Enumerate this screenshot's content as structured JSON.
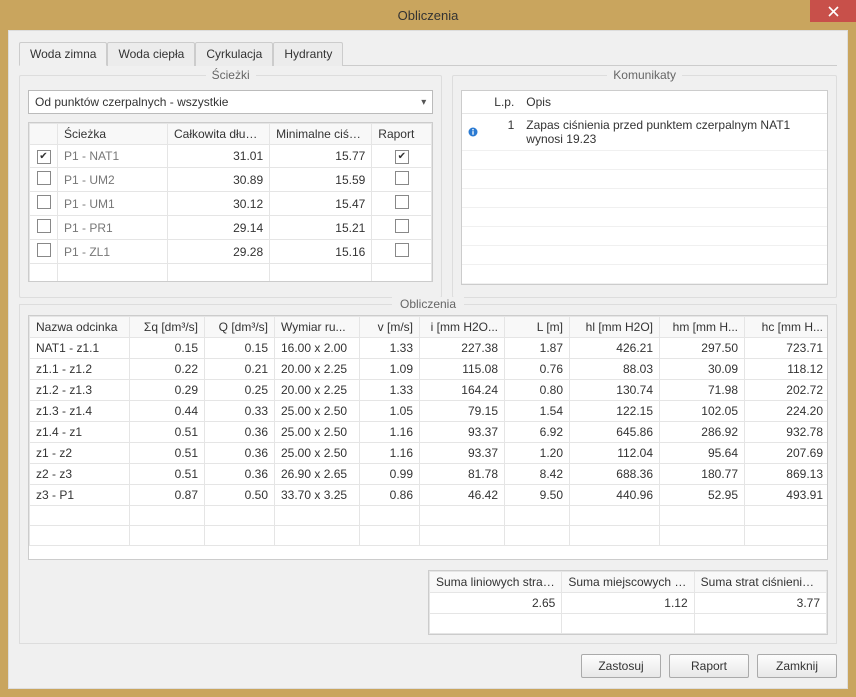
{
  "window": {
    "title": "Obliczenia"
  },
  "tabs": {
    "items": [
      {
        "label": "Woda zimna",
        "active": true
      },
      {
        "label": "Woda ciepła",
        "active": false
      },
      {
        "label": "Cyrkulacja",
        "active": false
      },
      {
        "label": "Hydranty",
        "active": false
      }
    ]
  },
  "paths_group": {
    "legend": "Ścieżki",
    "dropdown": "Od punktów czerpalnych - wszystkie",
    "columns": {
      "check": "",
      "path": "Ścieżka",
      "length": "Całkowita długo...",
      "min_press": "Minimalne ciśnie...",
      "report": "Raport"
    },
    "rows": [
      {
        "checked": true,
        "path": "P1 - NAT1",
        "length": "31.01",
        "min_press": "15.77",
        "report": true
      },
      {
        "checked": false,
        "path": "P1 - UM2",
        "length": "30.89",
        "min_press": "15.59",
        "report": false
      },
      {
        "checked": false,
        "path": "P1 - UM1",
        "length": "30.12",
        "min_press": "15.47",
        "report": false
      },
      {
        "checked": false,
        "path": "P1 - PR1",
        "length": "29.14",
        "min_press": "15.21",
        "report": false
      },
      {
        "checked": false,
        "path": "P1 - ZL1",
        "length": "29.28",
        "min_press": "15.16",
        "report": false
      }
    ]
  },
  "messages_group": {
    "legend": "Komunikaty",
    "columns": {
      "icon": "",
      "lp": "L.p.",
      "desc": "Opis"
    },
    "rows": [
      {
        "icon": "info",
        "lp": "1",
        "desc": "Zapas ciśnienia przed punktem czerpalnym NAT1 wynosi 19.23"
      }
    ]
  },
  "calc_group": {
    "legend": "Obliczenia",
    "columns": {
      "name": "Nazwa odcinka",
      "sq": "Σq [dm³/s]",
      "q": "Q [dm³/s]",
      "dim": "Wymiar ru...",
      "v": "v [m/s]",
      "i": "i [mm H2O...",
      "l": "L [m]",
      "hl": "hl [mm H2O]",
      "hm": "hm [mm H...",
      "hc": "hc [mm H..."
    },
    "rows": [
      {
        "name": "NAT1 - z1.1",
        "sq": "0.15",
        "q": "0.15",
        "dim": "16.00 x 2.00",
        "v": "1.33",
        "i": "227.38",
        "l": "1.87",
        "hl": "426.21",
        "hm": "297.50",
        "hc": "723.71"
      },
      {
        "name": "z1.1 - z1.2",
        "sq": "0.22",
        "q": "0.21",
        "dim": "20.00 x 2.25",
        "v": "1.09",
        "i": "115.08",
        "l": "0.76",
        "hl": "88.03",
        "hm": "30.09",
        "hc": "118.12"
      },
      {
        "name": "z1.2 - z1.3",
        "sq": "0.29",
        "q": "0.25",
        "dim": "20.00 x 2.25",
        "v": "1.33",
        "i": "164.24",
        "l": "0.80",
        "hl": "130.74",
        "hm": "71.98",
        "hc": "202.72"
      },
      {
        "name": "z1.3 - z1.4",
        "sq": "0.44",
        "q": "0.33",
        "dim": "25.00 x 2.50",
        "v": "1.05",
        "i": "79.15",
        "l": "1.54",
        "hl": "122.15",
        "hm": "102.05",
        "hc": "224.20"
      },
      {
        "name": "z1.4 - z1",
        "sq": "0.51",
        "q": "0.36",
        "dim": "25.00 x 2.50",
        "v": "1.16",
        "i": "93.37",
        "l": "6.92",
        "hl": "645.86",
        "hm": "286.92",
        "hc": "932.78"
      },
      {
        "name": "z1 - z2",
        "sq": "0.51",
        "q": "0.36",
        "dim": "25.00 x 2.50",
        "v": "1.16",
        "i": "93.37",
        "l": "1.20",
        "hl": "112.04",
        "hm": "95.64",
        "hc": "207.69"
      },
      {
        "name": "z2 - z3",
        "sq": "0.51",
        "q": "0.36",
        "dim": "26.90 x 2.65",
        "v": "0.99",
        "i": "81.78",
        "l": "8.42",
        "hl": "688.36",
        "hm": "180.77",
        "hc": "869.13"
      },
      {
        "name": "z3 - P1",
        "sq": "0.87",
        "q": "0.50",
        "dim": "33.70 x 3.25",
        "v": "0.86",
        "i": "46.42",
        "l": "9.50",
        "hl": "440.96",
        "hm": "52.95",
        "hc": "493.91"
      }
    ],
    "summary": {
      "columns": {
        "lin": "Suma liniowych strat ...",
        "loc": "Suma miejscowych s...",
        "tot": "Suma strat ciśnienia ..."
      },
      "values": {
        "lin": "2.65",
        "loc": "1.12",
        "tot": "3.77"
      }
    }
  },
  "buttons": {
    "apply": "Zastosuj",
    "report": "Raport",
    "close": "Zamknij"
  }
}
